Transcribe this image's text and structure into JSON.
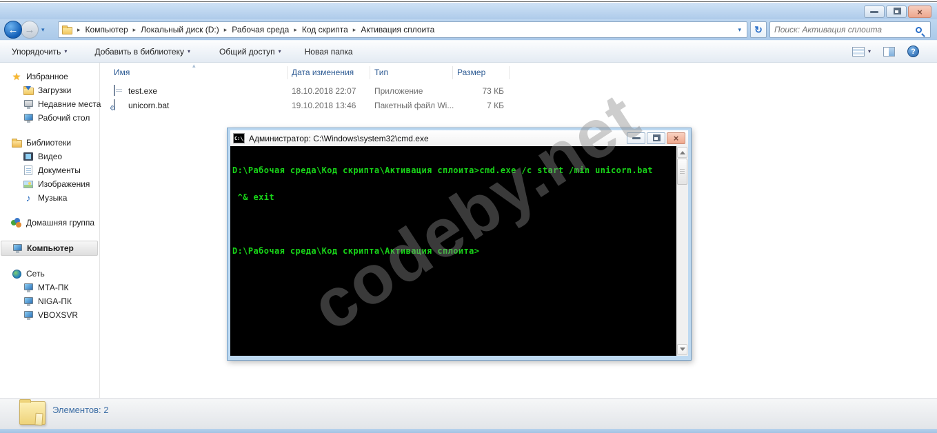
{
  "icons": {
    "star": "★",
    "music": "♪",
    "back": "←",
    "forward": "→",
    "refresh": "↻",
    "dropdown": "▾",
    "crumb_sep": "▸",
    "sort_asc": "▴",
    "help": "?",
    "close_x": "×",
    "cmd_icon_label": "C:\\_"
  },
  "nav": {
    "breadcrumb": [
      "Компьютер",
      "Локальный диск (D:)",
      "Рабочая среда",
      "Код скрипта",
      "Активация сплоита"
    ],
    "search_placeholder": "Поиск: Активация сплоита"
  },
  "toolbar": {
    "items": [
      {
        "label": "Упорядочить"
      },
      {
        "label": "Добавить в библиотеку"
      },
      {
        "label": "Общий доступ"
      },
      {
        "label": "Новая папка"
      }
    ]
  },
  "sidebar": {
    "groups": [
      {
        "label": "Избранное",
        "items": [
          "Загрузки",
          "Недавние места",
          "Рабочий стол"
        ]
      },
      {
        "label": "Библиотеки",
        "items": [
          "Видео",
          "Документы",
          "Изображения",
          "Музыка"
        ]
      },
      {
        "label": "Домашняя группа",
        "items": []
      },
      {
        "label": "Компьютер",
        "items": []
      },
      {
        "label": "Сеть",
        "items": [
          "МТА-ПК",
          "NIGA-ПК",
          "VBOXSVR"
        ]
      }
    ]
  },
  "files": {
    "columns": [
      "Имя",
      "Дата изменения",
      "Тип",
      "Размер"
    ],
    "rows": [
      {
        "name": "test.exe",
        "date": "18.10.2018 22:07",
        "type": "Приложение",
        "size": "73 КБ"
      },
      {
        "name": "unicorn.bat",
        "date": "19.10.2018 13:46",
        "type": "Пакетный файл Wi...",
        "size": "7 КБ"
      }
    ]
  },
  "cmd": {
    "title": "Администратор: C:\\Windows\\system32\\cmd.exe",
    "lines": [
      "D:\\Рабочая среда\\Код скрипта\\Активация сплоита>cmd.exe /c start /min unicorn.bat",
      " ^& exit",
      "",
      "D:\\Рабочая среда\\Код скрипта\\Активация сплоита>"
    ]
  },
  "status": {
    "text": "Элементов: 2"
  },
  "watermark": {
    "text": "codeby.net"
  }
}
